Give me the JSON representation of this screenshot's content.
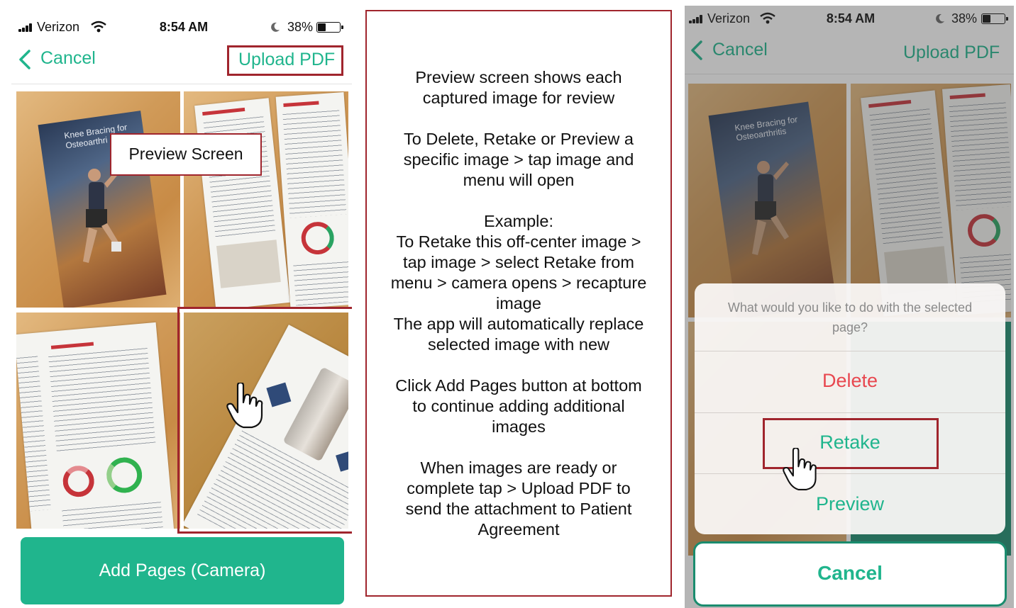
{
  "left_screen": {
    "status_bar": {
      "carrier": "Verizon",
      "time": "8:54 AM",
      "battery": "38%"
    },
    "nav": {
      "cancel_label": "Cancel",
      "upload_label": "Upload PDF"
    },
    "preview_callout": "Preview Screen",
    "brochure_cover_title": "Knee Bracing for Osteoarthri",
    "add_pages_label": "Add Pages (Camera)"
  },
  "instructions": {
    "paragraphs": [
      "Preview screen shows each\ncaptured image for review",
      "To Delete, Retake or Preview a\nspecific image > tap image and\nmenu will open",
      "Example:\nTo Retake this off-center image >\ntap image > select Retake from\nmenu > camera opens > recapture\nimage\nThe app will automatically replace\nselected image with new",
      "Click Add Pages button at bottom\nto continue adding additional\nimages",
      "When images are ready or\ncomplete tap > Upload PDF to\nsend the attachment to Patient\nAgreement"
    ]
  },
  "right_screen": {
    "status_bar": {
      "carrier": "Verizon",
      "time": "8:54 AM",
      "battery": "38%"
    },
    "nav": {
      "cancel_label": "Cancel",
      "upload_label": "Upload PDF"
    },
    "brochure_cover_title": "Knee Bracing for Osteoarthritis",
    "action_sheet": {
      "prompt": "What would you like to do with the selected page?",
      "options": [
        "Delete",
        "Retake",
        "Preview"
      ],
      "cancel_label": "Cancel"
    }
  },
  "colors": {
    "accent": "#20b58d",
    "highlight_border": "#a0252d",
    "destructive": "#e8474f"
  }
}
